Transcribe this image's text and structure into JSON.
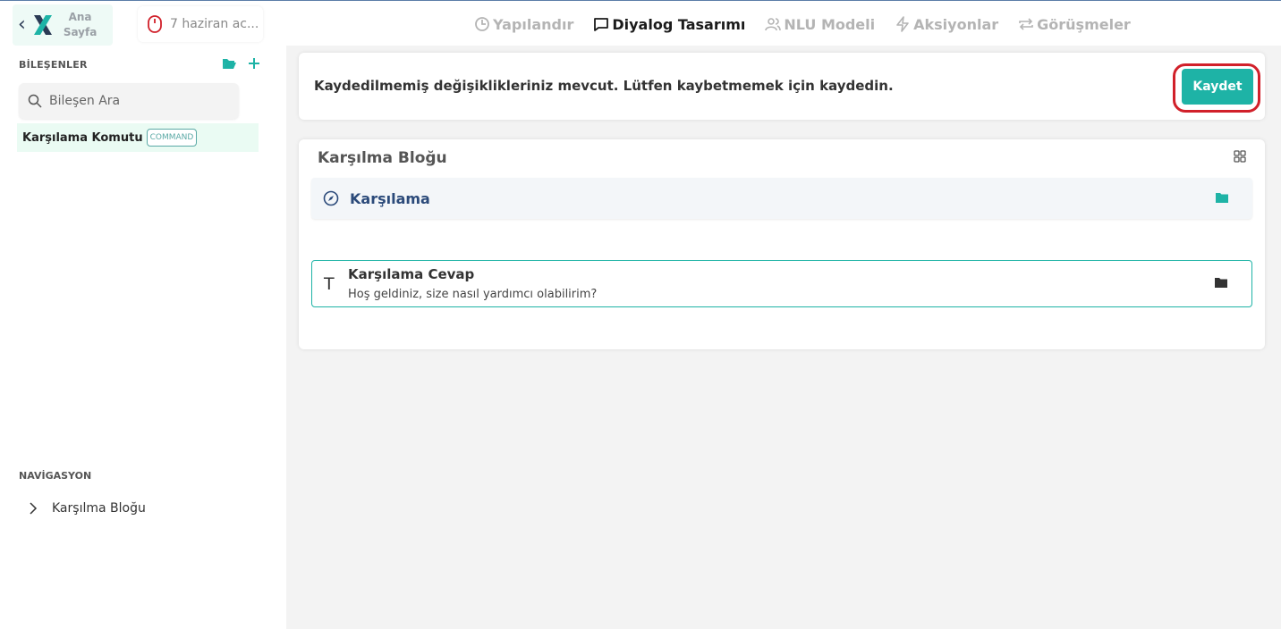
{
  "header": {
    "home_label_line1": "Ana",
    "home_label_line2": "Sayfa",
    "project_name": "7 haziran ac...",
    "tabs": [
      {
        "label": "Yapılandır",
        "icon": "clock-icon",
        "active": false
      },
      {
        "label": "Diyalog Tasarımı",
        "icon": "chat-icon",
        "active": true
      },
      {
        "label": "NLU Modeli",
        "icon": "users-icon",
        "active": false
      },
      {
        "label": "Aksiyonlar",
        "icon": "bolt-icon",
        "active": false
      },
      {
        "label": "Görüşmeler",
        "icon": "repeat-icon",
        "active": false
      }
    ]
  },
  "sidebar": {
    "components_title": "BİLEŞENLER",
    "search_placeholder": "Bileşen Ara",
    "items": [
      {
        "label": "Karşılama Komutu",
        "badge": "COMMAND"
      }
    ],
    "navigation_title": "NAVİGASYON",
    "nav_items": [
      {
        "label": "Karşılma Bloğu"
      }
    ]
  },
  "alert": {
    "message": "Kaydedilmemiş değişiklikleriniz mevcut. Lütfen kaybetmemek için kaydedin.",
    "save_label": "Kaydet"
  },
  "block": {
    "title": "Karşılma Bloğu",
    "intent_label": "Karşılama",
    "response_title": "Karşılama Cevap",
    "response_text": "Hoş geldiniz, size nasıl yardımcı olabilirim?"
  },
  "colors": {
    "accent": "#1eb3a6",
    "highlight_ring": "#d1202a",
    "intent_text": "#2b4a7a"
  }
}
